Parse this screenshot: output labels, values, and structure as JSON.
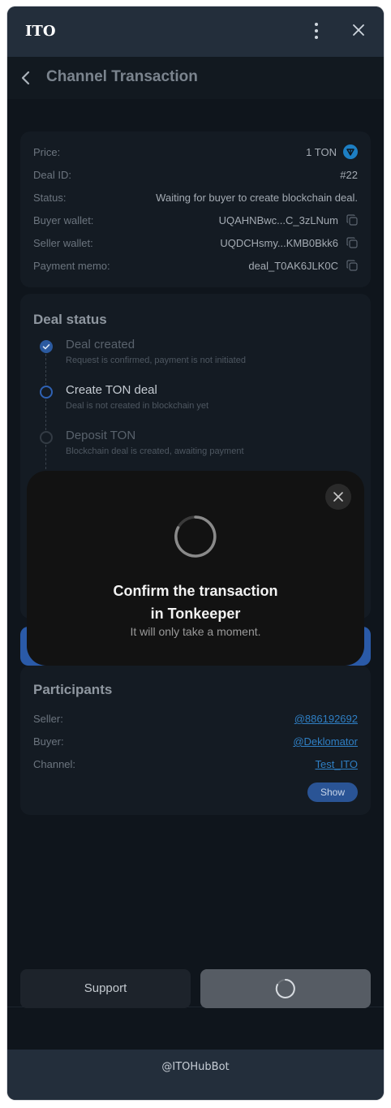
{
  "window": {
    "title": "ITO"
  },
  "header": {
    "title": "Channel Transaction"
  },
  "details": {
    "price_label": "Price:",
    "price_value": "1 TON",
    "deal_id_label": "Deal ID:",
    "deal_id_value": "#22",
    "status_label": "Status:",
    "status_value": "Waiting for buyer to create blockchain deal.",
    "buyer_wallet_label": "Buyer wallet:",
    "buyer_wallet_value": "UQAHNBwc...C_3zLNum",
    "seller_wallet_label": "Seller wallet:",
    "seller_wallet_value": "UQDCHsmy...KMB0Bkk6",
    "memo_label": "Payment memo:",
    "memo_value": "deal_T0AK6JLK0C"
  },
  "deal_status": {
    "title": "Deal status",
    "steps": [
      {
        "title": "Deal created",
        "desc": "Request is confirmed, payment is not initiated",
        "state": "done"
      },
      {
        "title": "Create TON deal",
        "desc": "Deal is not created in blockchain yet",
        "state": "current"
      },
      {
        "title": "Deposit TON",
        "desc": "Blockchain deal is created, awaiting payment",
        "state": "pending"
      }
    ]
  },
  "participants": {
    "title": "Participants",
    "seller_label": "Seller:",
    "seller_value": "@886192692",
    "buyer_label": "Buyer:",
    "buyer_value": "@Deklomator",
    "channel_label": "Channel:",
    "channel_value": "Test_ITO",
    "show_label": "Show"
  },
  "modal": {
    "title_line1": "Confirm the transaction",
    "title_line2": "in Tonkeeper",
    "subtitle": "It will only take a moment."
  },
  "actions": {
    "support_label": "Support"
  },
  "footer": {
    "bot_name": "@ITOHubBot"
  },
  "colors": {
    "accent": "#2a5495",
    "link": "#2f7fc4",
    "background": "#0f151c"
  }
}
